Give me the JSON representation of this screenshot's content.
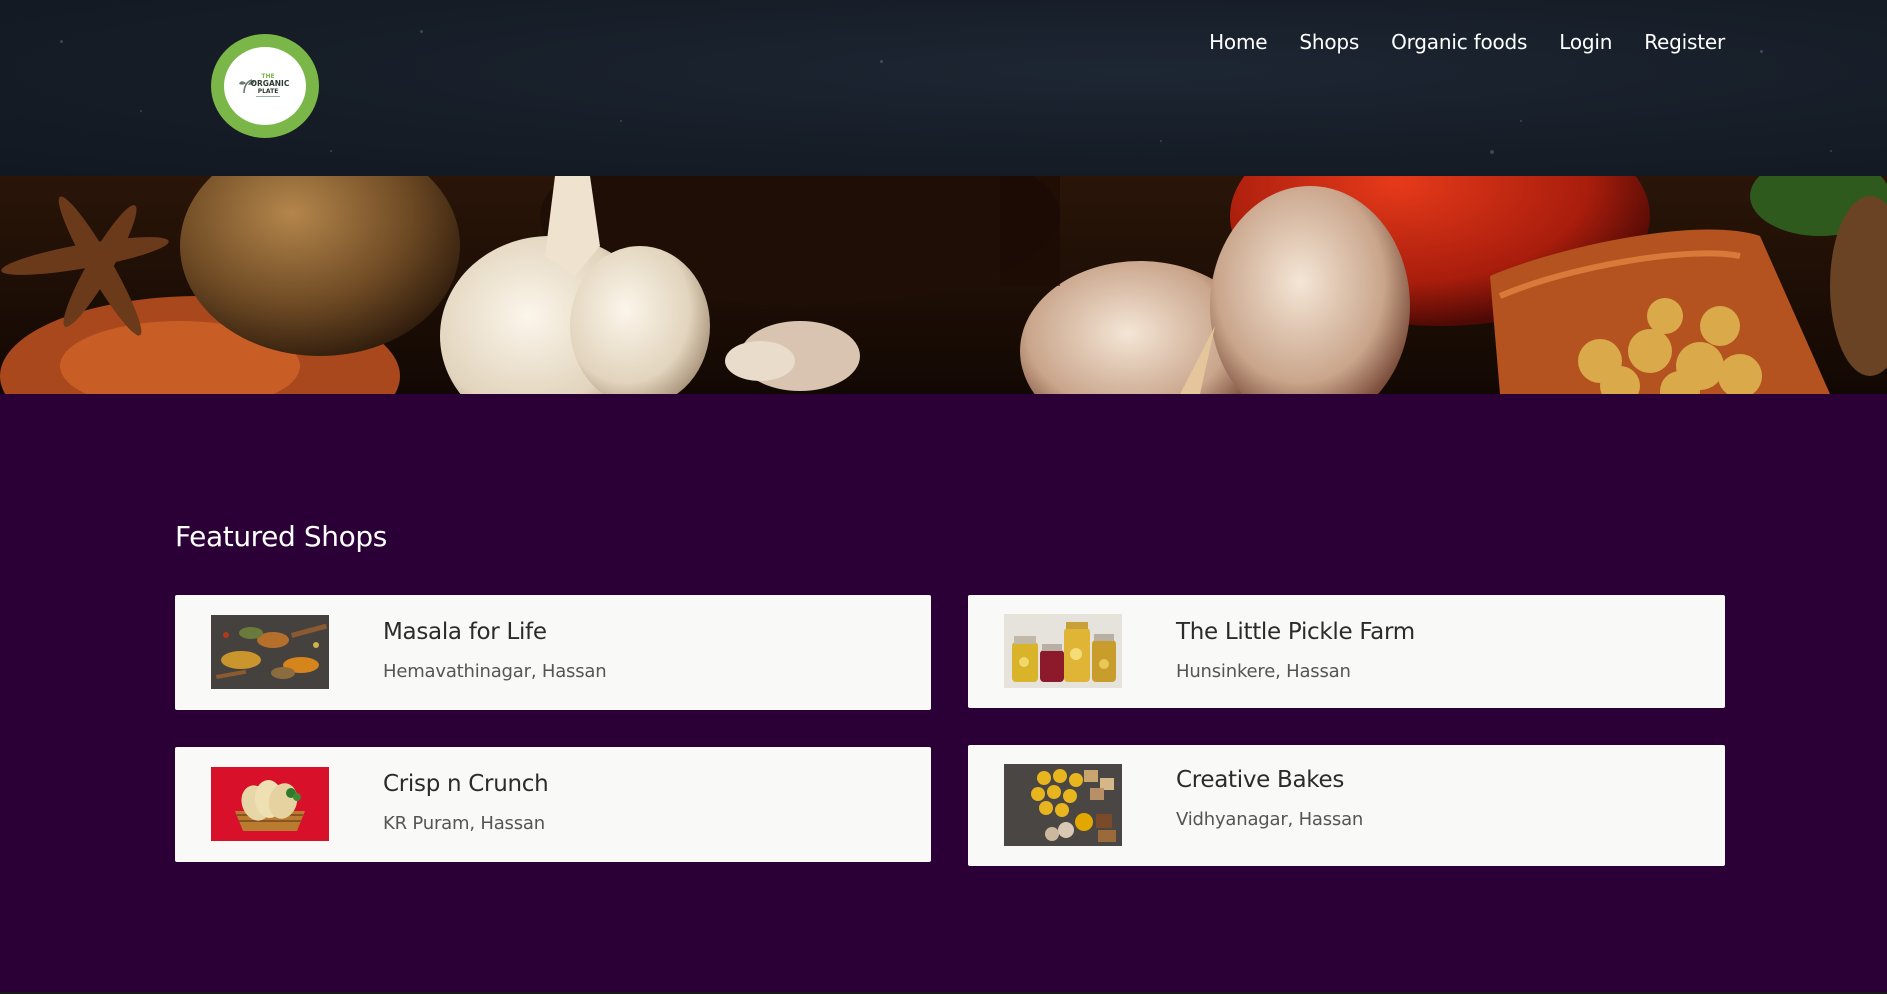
{
  "brand": {
    "logo_alt": "The Organic Plate",
    "logo_line1": "THE",
    "logo_line2": "ORGANIC",
    "logo_line3": "PLATE",
    "colors": {
      "ring": "#7ab648",
      "header_bg": "#161d27",
      "main_bg": "#2a0037"
    }
  },
  "nav": {
    "items": [
      {
        "label": "Home"
      },
      {
        "label": "Shops"
      },
      {
        "label": "Organic foods"
      },
      {
        "label": "Login"
      },
      {
        "label": "Register"
      }
    ]
  },
  "featured": {
    "title": "Featured Shops",
    "shops": [
      {
        "name": "Masala for Life",
        "location": "Hemavathinagar, Hassan",
        "image": "spices-thumbnail"
      },
      {
        "name": "The Little Pickle Farm",
        "location": "Hunsinkere, Hassan",
        "image": "pickle-jars-thumbnail"
      },
      {
        "name": "Crisp n Crunch",
        "location": "KR Puram, Hassan",
        "image": "papad-basket-thumbnail"
      },
      {
        "name": "Creative Bakes",
        "location": "Vidhyanagar, Hassan",
        "image": "sweets-platter-thumbnail"
      }
    ]
  }
}
